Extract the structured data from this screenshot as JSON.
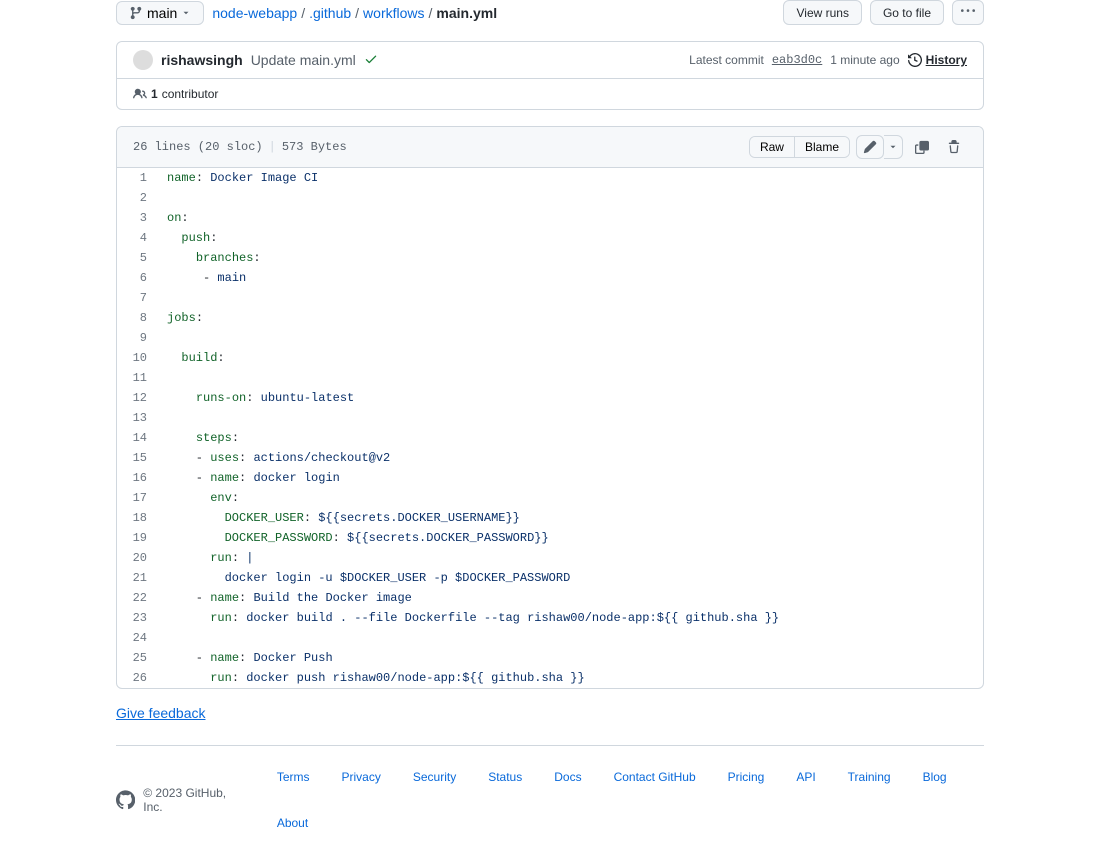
{
  "branch": "main",
  "breadcrumb": {
    "parts": [
      "node-webapp",
      ".github",
      "workflows"
    ],
    "final": "main.yml"
  },
  "top_actions": {
    "view_runs": "View runs",
    "go_to_file": "Go to file"
  },
  "commit": {
    "author": "rishawsingh",
    "message": "Update main.yml",
    "latest_label": "Latest commit",
    "sha": "eab3d0c",
    "time": "1 minute ago",
    "history": "History"
  },
  "contributors": {
    "count": "1",
    "label": "contributor"
  },
  "file_info": {
    "lines": "26 lines (20 sloc)",
    "size": "573 Bytes"
  },
  "file_actions": {
    "raw": "Raw",
    "blame": "Blame"
  },
  "code": [
    {
      "n": "1",
      "html": "<span class='pl-ent'>name</span>: <span class='pl-s'>Docker Image CI</span>"
    },
    {
      "n": "2",
      "html": ""
    },
    {
      "n": "3",
      "html": "<span class='pl-ent'>on</span>:"
    },
    {
      "n": "4",
      "html": "  <span class='pl-ent'>push</span>:"
    },
    {
      "n": "5",
      "html": "    <span class='pl-ent'>branches</span>:"
    },
    {
      "n": "6",
      "html": "     - <span class='pl-s'>main</span>"
    },
    {
      "n": "7",
      "html": ""
    },
    {
      "n": "8",
      "html": "<span class='pl-ent'>jobs</span>:"
    },
    {
      "n": "9",
      "html": ""
    },
    {
      "n": "10",
      "html": "  <span class='pl-ent'>build</span>:"
    },
    {
      "n": "11",
      "html": ""
    },
    {
      "n": "12",
      "html": "    <span class='pl-ent'>runs-on</span>: <span class='pl-s'>ubuntu-latest</span>"
    },
    {
      "n": "13",
      "html": ""
    },
    {
      "n": "14",
      "html": "    <span class='pl-ent'>steps</span>:"
    },
    {
      "n": "15",
      "html": "    - <span class='pl-ent'>uses</span>: <span class='pl-s'>actions/checkout@v2</span>"
    },
    {
      "n": "16",
      "html": "    - <span class='pl-ent'>name</span>: <span class='pl-s'>docker login</span>"
    },
    {
      "n": "17",
      "html": "      <span class='pl-ent'>env</span>:"
    },
    {
      "n": "18",
      "html": "        <span class='pl-ent'>DOCKER_USER</span>: <span class='pl-s'>${{secrets.DOCKER_USERNAME}}</span>"
    },
    {
      "n": "19",
      "html": "        <span class='pl-ent'>DOCKER_PASSWORD</span>: <span class='pl-s'>${{secrets.DOCKER_PASSWORD}}</span>"
    },
    {
      "n": "20",
      "html": "      <span class='pl-ent'>run</span>: <span class='pl-s'>|</span>"
    },
    {
      "n": "21",
      "html": "<span class='pl-s'>        docker login -u $DOCKER_USER -p $DOCKER_PASSWORD</span>"
    },
    {
      "n": "22",
      "html": "    - <span class='pl-ent'>name</span>: <span class='pl-s'>Build the Docker image</span>"
    },
    {
      "n": "23",
      "html": "      <span class='pl-ent'>run</span>: <span class='pl-s'>docker build . --file Dockerfile --tag rishaw00/node-app:${{ github.sha }}</span>"
    },
    {
      "n": "24",
      "html": ""
    },
    {
      "n": "25",
      "html": "    - <span class='pl-ent'>name</span>: <span class='pl-s'>Docker Push</span>"
    },
    {
      "n": "26",
      "html": "      <span class='pl-ent'>run</span>: <span class='pl-s'>docker push rishaw00/node-app:${{ github.sha }}</span>"
    }
  ],
  "feedback": "Give feedback",
  "footer": {
    "copyright": "© 2023 GitHub, Inc.",
    "links": [
      "Terms",
      "Privacy",
      "Security",
      "Status",
      "Docs",
      "Contact GitHub",
      "Pricing",
      "API",
      "Training",
      "Blog",
      "About"
    ]
  }
}
